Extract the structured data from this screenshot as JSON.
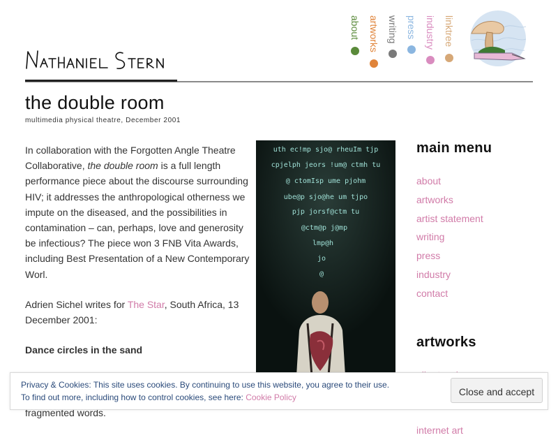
{
  "site": {
    "signature_text": "Nathaniel Stern"
  },
  "top_nav": [
    {
      "label": "about",
      "color": "#5a8a3a"
    },
    {
      "label": "artworks",
      "color": "#e0843a"
    },
    {
      "label": "writing",
      "color": "#7a7a7a"
    },
    {
      "label": "press",
      "color": "#8bb6e0"
    },
    {
      "label": "industry",
      "color": "#d98cbf"
    },
    {
      "label": "linktree",
      "color": "#d6a877"
    }
  ],
  "page": {
    "title": "the double room",
    "subtitle": "multimedia physical theatre, December 2001",
    "p1_a": "In collaboration with the Forgotten Angle Theatre Collaborative, ",
    "p1_em": "the double room",
    "p1_b": " is a full length performance piece about the discourse surrounding HIV; it addresses the anthropological otherness we impute on the diseased, and the possibilities in contamination – can, perhaps, love and generosity be infectious? The piece won 3 FNB Vita Awards, including Best Presentation of a New Contemporary Worl.",
    "p2_a": "Adrien Sichel writes for ",
    "p2_link": "The Star",
    "p2_b": ", South Africa, 13 December 2001:",
    "p3": "Dance circles in the sand",
    "p4_tail": "fragmented words."
  },
  "photo": {
    "projected_lines": [
      "uth ec!mp sjo@ rheuIm tjp",
      "cpjelph jeors !um@ ctmh tu",
      "@ ctomIsp ume pjohm",
      "ube@p sjo@he um tjpo",
      "pjp jorsf@ctm tu",
      "@ctm@p j@mp",
      "lmp@h",
      "jo",
      "@"
    ]
  },
  "sidebar": {
    "main_menu_title": "main menu",
    "main_menu": [
      "about",
      "artworks",
      "artist statement",
      "writing",
      "press",
      "industry",
      "contact"
    ],
    "artworks_title": "artworks",
    "artworks_list": [
      "all artworks",
      "internet art"
    ]
  },
  "cookie": {
    "line1": "Privacy & Cookies: This site uses cookies. By continuing to use this website, you agree to their use.",
    "line2": "To find out more, including how to control cookies, see here: ",
    "link": "Cookie Policy",
    "button": "Close and accept"
  }
}
